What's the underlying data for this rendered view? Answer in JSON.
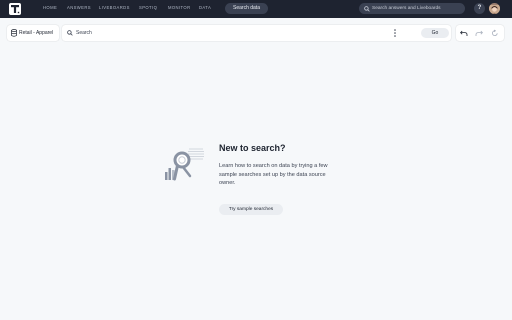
{
  "topbar": {
    "nav": [
      "HOME",
      "ANSWERS",
      "LIVEBOARDS",
      "SPOTIQ",
      "MONITOR",
      "DATA"
    ],
    "search_data_label": "Search data",
    "global_search_placeholder": "Search answers and Liveboards",
    "help_label": "?"
  },
  "toolbar": {
    "data_source": "Retail - Apparel",
    "search_placeholder": "Search",
    "go_label": "Go"
  },
  "empty_state": {
    "title": "New to search?",
    "description": "Learn how to search on data by trying a few sample searches set up by the data source owner.",
    "button_label": "Try sample searches"
  },
  "colors": {
    "topbar_bg": "#1e2330",
    "page_bg": "#f6f8fa",
    "pill_bg": "#3a4152",
    "button_bg": "#eaedf1"
  }
}
